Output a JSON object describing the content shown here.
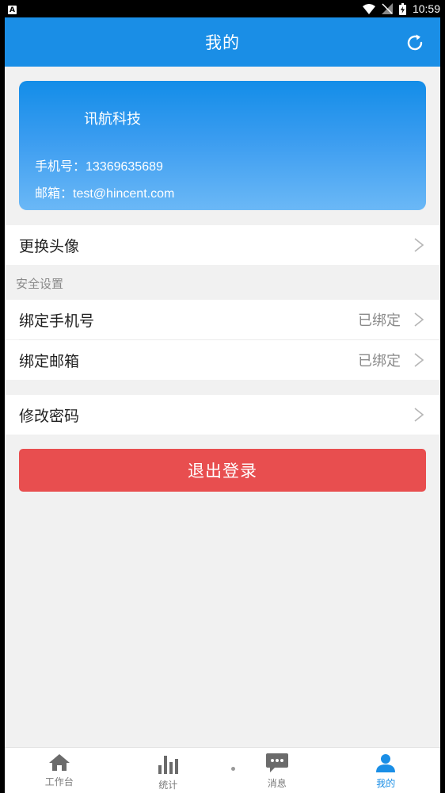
{
  "status_bar": {
    "badge": "A",
    "time": "10:59"
  },
  "header": {
    "title": "我的"
  },
  "profile": {
    "company": "讯航科技",
    "phone_label": "手机号：",
    "phone": "13369635689",
    "email_label": "邮箱：",
    "email": "test@hincent.com"
  },
  "menu": {
    "avatar": {
      "label": "更换头像"
    },
    "security_title": "安全设置",
    "bind_phone": {
      "label": "绑定手机号",
      "value": "已绑定"
    },
    "bind_email": {
      "label": "绑定邮箱",
      "value": "已绑定"
    },
    "change_password": {
      "label": "修改密码"
    }
  },
  "logout_label": "退出登录",
  "tabs": [
    {
      "label": "工作台",
      "icon": "home-icon"
    },
    {
      "label": "统计",
      "icon": "bar-chart-icon"
    },
    {
      "label": "消息",
      "icon": "chat-icon"
    },
    {
      "label": "我的",
      "icon": "user-icon"
    }
  ],
  "colors": {
    "primary": "#1a8ee6",
    "logout": "#e84e4f",
    "background": "#f1f1f1"
  }
}
